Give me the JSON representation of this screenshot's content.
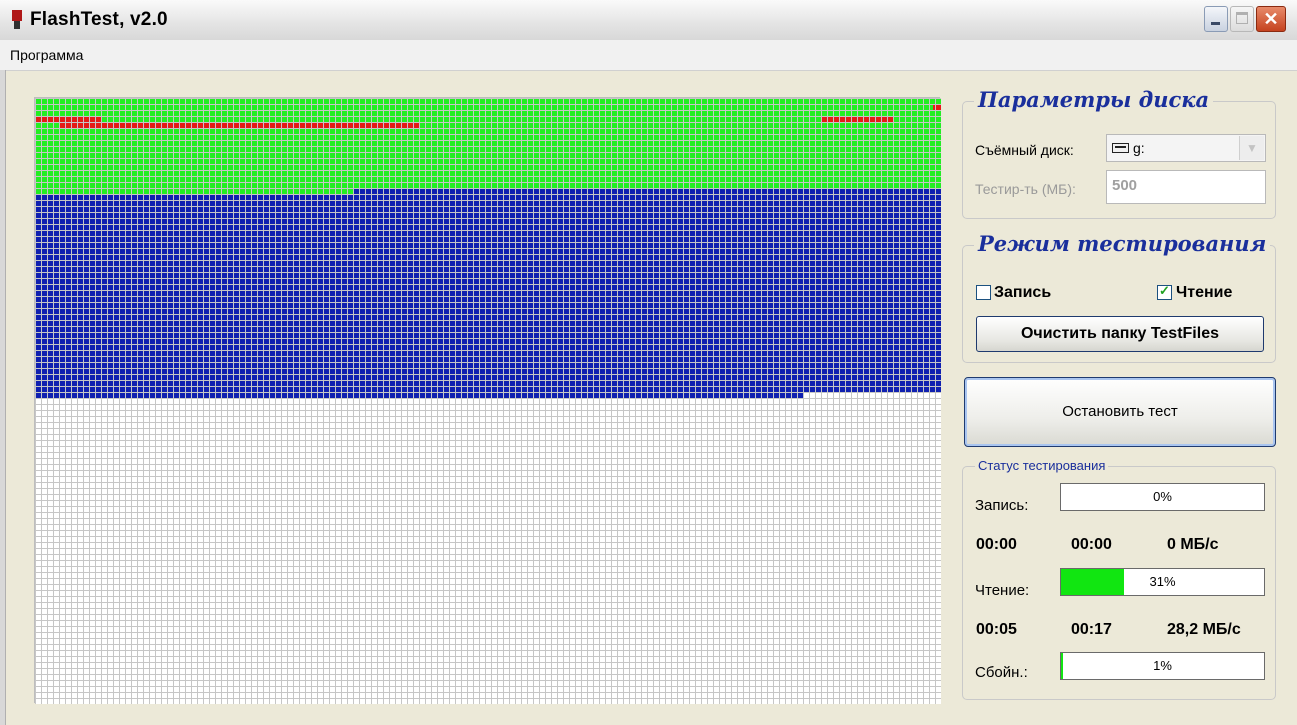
{
  "window": {
    "title": "FlashTest, v2.0"
  },
  "menu": {
    "items": [
      {
        "label": "Программа"
      }
    ]
  },
  "grid": {
    "colors": {
      "bad": "#e41b17",
      "read_ok": "#22ee22",
      "written": "#1020b0",
      "empty": "#ffffff",
      "line": "#c6c6c6"
    }
  },
  "disk_params": {
    "title": "Параметры диска",
    "drive_label": "Съёмный диск:",
    "drive_value": "g:",
    "size_label": "Тестир-ть (МБ):",
    "size_value": "500"
  },
  "test_mode": {
    "title": "Режим тестирования",
    "write": {
      "label": "Запись",
      "checked": false
    },
    "read": {
      "label": "Чтение",
      "checked": true
    },
    "clean_button": "Очистить папку TestFiles"
  },
  "stop_button": "Остановить тест",
  "status": {
    "title": "Статус тестирования",
    "write": {
      "label": "Запись:",
      "percent_text": "0%",
      "progress": 0,
      "elapsed": "00:00",
      "remaining": "00:00",
      "speed": "0 МБ/с"
    },
    "read": {
      "label": "Чтение:",
      "percent_text": "31%",
      "progress": 0.31,
      "elapsed": "00:05",
      "remaining": "00:17",
      "speed": "28,2 МБ/с"
    },
    "errors": {
      "label": "Сбойн.:",
      "percent_text": "1%",
      "progress": 0.01
    }
  },
  "colors": {
    "accent_title": "#1a2f9c",
    "progress_fill": "#11e611"
  }
}
